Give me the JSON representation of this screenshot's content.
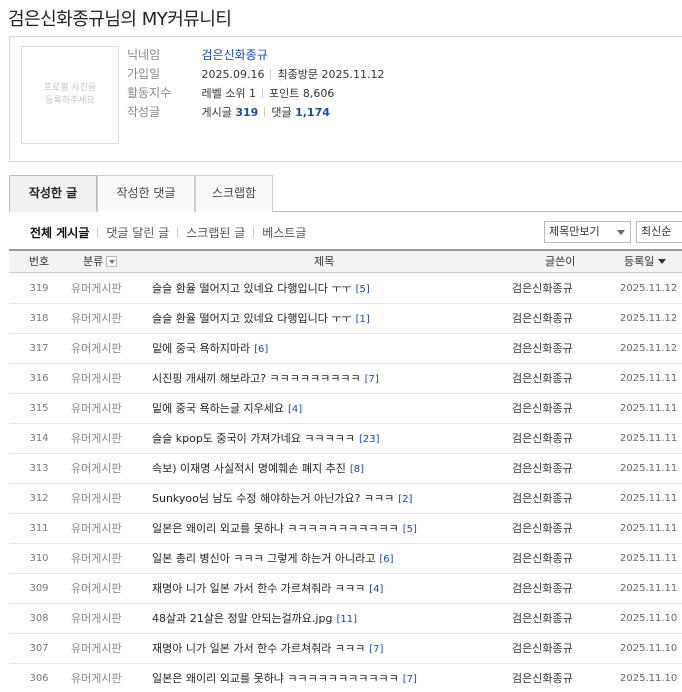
{
  "page_title": "검은신화종규님의 MY커뮤니티",
  "profile": {
    "avatar_text": "프로필 사진을 등록하주세요",
    "labels": {
      "nickname": "닉네임",
      "joined": "가입일",
      "activity": "활동지수",
      "posts": "작성글"
    },
    "nickname": "검은신화종규",
    "join_date": "2025.09.16",
    "last_visit_label": "최종방문",
    "last_visit": "2025.11.12",
    "level_label": "레벨 소위 1",
    "points_label": "포인트 8,606",
    "post_count_label": "게시글",
    "post_count": "319",
    "comment_count_label": "댓글",
    "comment_count": "1,174"
  },
  "tabs": [
    "작성한 글",
    "작성한 댓글",
    "스크랩함"
  ],
  "subnav": [
    "전체 게시글",
    "댓글 달린 글",
    "스크랩된 글",
    "베스트글"
  ],
  "filter_select": "제목만보기",
  "sort_select": "최신순",
  "table_headers": {
    "no": "번호",
    "category": "분류",
    "title": "제목",
    "author": "글쓴이",
    "date": "등록일"
  },
  "rows": [
    {
      "no": "319",
      "category": "유머게시판",
      "title": "슬슬 환율 떨어지고 있네요 다행입니다 ㅜㅜ",
      "comments": "[5]",
      "author": "검은신화종규",
      "date": "2025.11.12"
    },
    {
      "no": "318",
      "category": "유머게시판",
      "title": "슬슬 환율 떨어지고 있네요 다행입니다 ㅜㅜ",
      "comments": "[1]",
      "author": "검은신화종규",
      "date": "2025.11.12"
    },
    {
      "no": "317",
      "category": "유머게시판",
      "title": "밑에 중국 욕하지마라",
      "comments": "[6]",
      "author": "검은신화종규",
      "date": "2025.11.12"
    },
    {
      "no": "316",
      "category": "유머게시판",
      "title": "시진핑 개새끼 해보라고? ㅋㅋㅋㅋㅋㅋㅋㅋㅋ",
      "comments": "[7]",
      "author": "검은신화종규",
      "date": "2025.11.11"
    },
    {
      "no": "315",
      "category": "유머게시판",
      "title": "밑에 중국 욕하는글 지우세요",
      "comments": "[4]",
      "author": "검은신화종규",
      "date": "2025.11.11"
    },
    {
      "no": "314",
      "category": "유머게시판",
      "title": "슬슬 kpop도 중국이 가져가네요 ㅋㅋㅋㅋㅋ",
      "comments": "[23]",
      "author": "검은신화종규",
      "date": "2025.11.11"
    },
    {
      "no": "313",
      "category": "유머게시판",
      "title": "속보) 이재명 사실적시 명예훼손 폐지 추진",
      "comments": "[8]",
      "author": "검은신화종규",
      "date": "2025.11.11"
    },
    {
      "no": "312",
      "category": "유머게시판",
      "title": "Sunkyoo님 남도 수정 해야하는거 아닌가요? ㅋㅋㅋ",
      "comments": "[2]",
      "author": "검은신화종규",
      "date": "2025.11.11"
    },
    {
      "no": "311",
      "category": "유머게시판",
      "title": "일본은 왜이리 외교를 못하냐 ㅋㅋㅋㅋㅋㅋㅋㅋㅋㅋㅋ",
      "comments": "[5]",
      "author": "검은신화종규",
      "date": "2025.11.11"
    },
    {
      "no": "310",
      "category": "유머게시판",
      "title": "일본 총리 병신아 ㅋㅋㅋ 그렇게 하는거 아니라고",
      "comments": "[6]",
      "author": "검은신화종규",
      "date": "2025.11.11"
    },
    {
      "no": "309",
      "category": "유머게시판",
      "title": "재명아 니가 일본 가서 한수 가르쳐줘라 ㅋㅋㅋ",
      "comments": "[4]",
      "author": "검은신화종규",
      "date": "2025.11.11"
    },
    {
      "no": "308",
      "category": "유머게시판",
      "title": "48살과 21살은 정말 안되는걸까요.jpg",
      "comments": "[11]",
      "author": "검은신화종규",
      "date": "2025.11.10"
    },
    {
      "no": "307",
      "category": "유머게시판",
      "title": "재명아 니가 일본 가서 한수 가르쳐줘라 ㅋㅋㅋ",
      "comments": "[7]",
      "author": "검은신화종규",
      "date": "2025.11.10"
    },
    {
      "no": "306",
      "category": "유머게시판",
      "title": "일본은 왜이리 외교를 못하냐 ㅋㅋㅋㅋㅋㅋㅋㅋㅋㅋㅋ",
      "comments": "[7]",
      "author": "검은신화종규",
      "date": "2025.11.10"
    }
  ]
}
